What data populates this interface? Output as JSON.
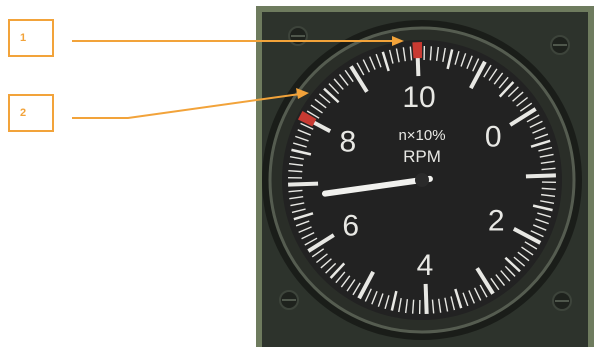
{
  "callouts": [
    {
      "label": "1"
    },
    {
      "label": "2"
    }
  ],
  "gauge": {
    "scale_labels": [
      "0",
      "2",
      "4",
      "6",
      "8",
      "10"
    ],
    "caption_top": "n×10%",
    "caption_bottom": "RPM",
    "needle_value": 6.8
  },
  "colors": {
    "callout": "#f2a33a",
    "marker": "#c83a32",
    "panel": "#2d332c",
    "bezel": "#6e7b5e",
    "face": "#222222",
    "ticks": "#e8e8e4"
  }
}
